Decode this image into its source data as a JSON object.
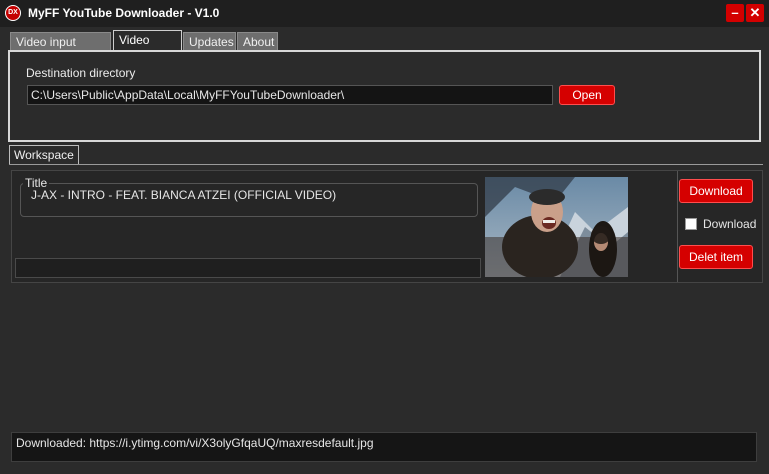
{
  "window": {
    "title": "MyFF YouTube Downloader - V1.0",
    "icon_text": "DX",
    "minimize_glyph": "–",
    "close_glyph": "✕"
  },
  "tabs": [
    {
      "label": "Video input source",
      "active": false
    },
    {
      "label": "Video output",
      "active": true
    },
    {
      "label": "Updates",
      "active": false
    },
    {
      "label": "About",
      "active": false
    }
  ],
  "output": {
    "destination_label": "Destination directory",
    "destination_value": "C:\\Users\\Public\\AppData\\Local\\MyFFYouTubeDownloader\\",
    "open_label": "Open"
  },
  "workspace": {
    "tab_label": "Workspace",
    "items": [
      {
        "title_legend": "Title",
        "title": "J-AX - INTRO - FEAT. BIANCA ATZEI (OFFICIAL VIDEO)",
        "progress": 0,
        "download_button": "Download",
        "download_checkbox_label": "Download",
        "download_checked": false,
        "delete_button": "Delet item"
      }
    ]
  },
  "status": {
    "text": "Downloaded: https://i.ytimg.com/vi/X3olyGfqaUQ/maxresdefault.jpg"
  },
  "colors": {
    "accent_red": "#d50000",
    "background": "#2b2b2b",
    "titlebar": "#1f1f1f"
  }
}
